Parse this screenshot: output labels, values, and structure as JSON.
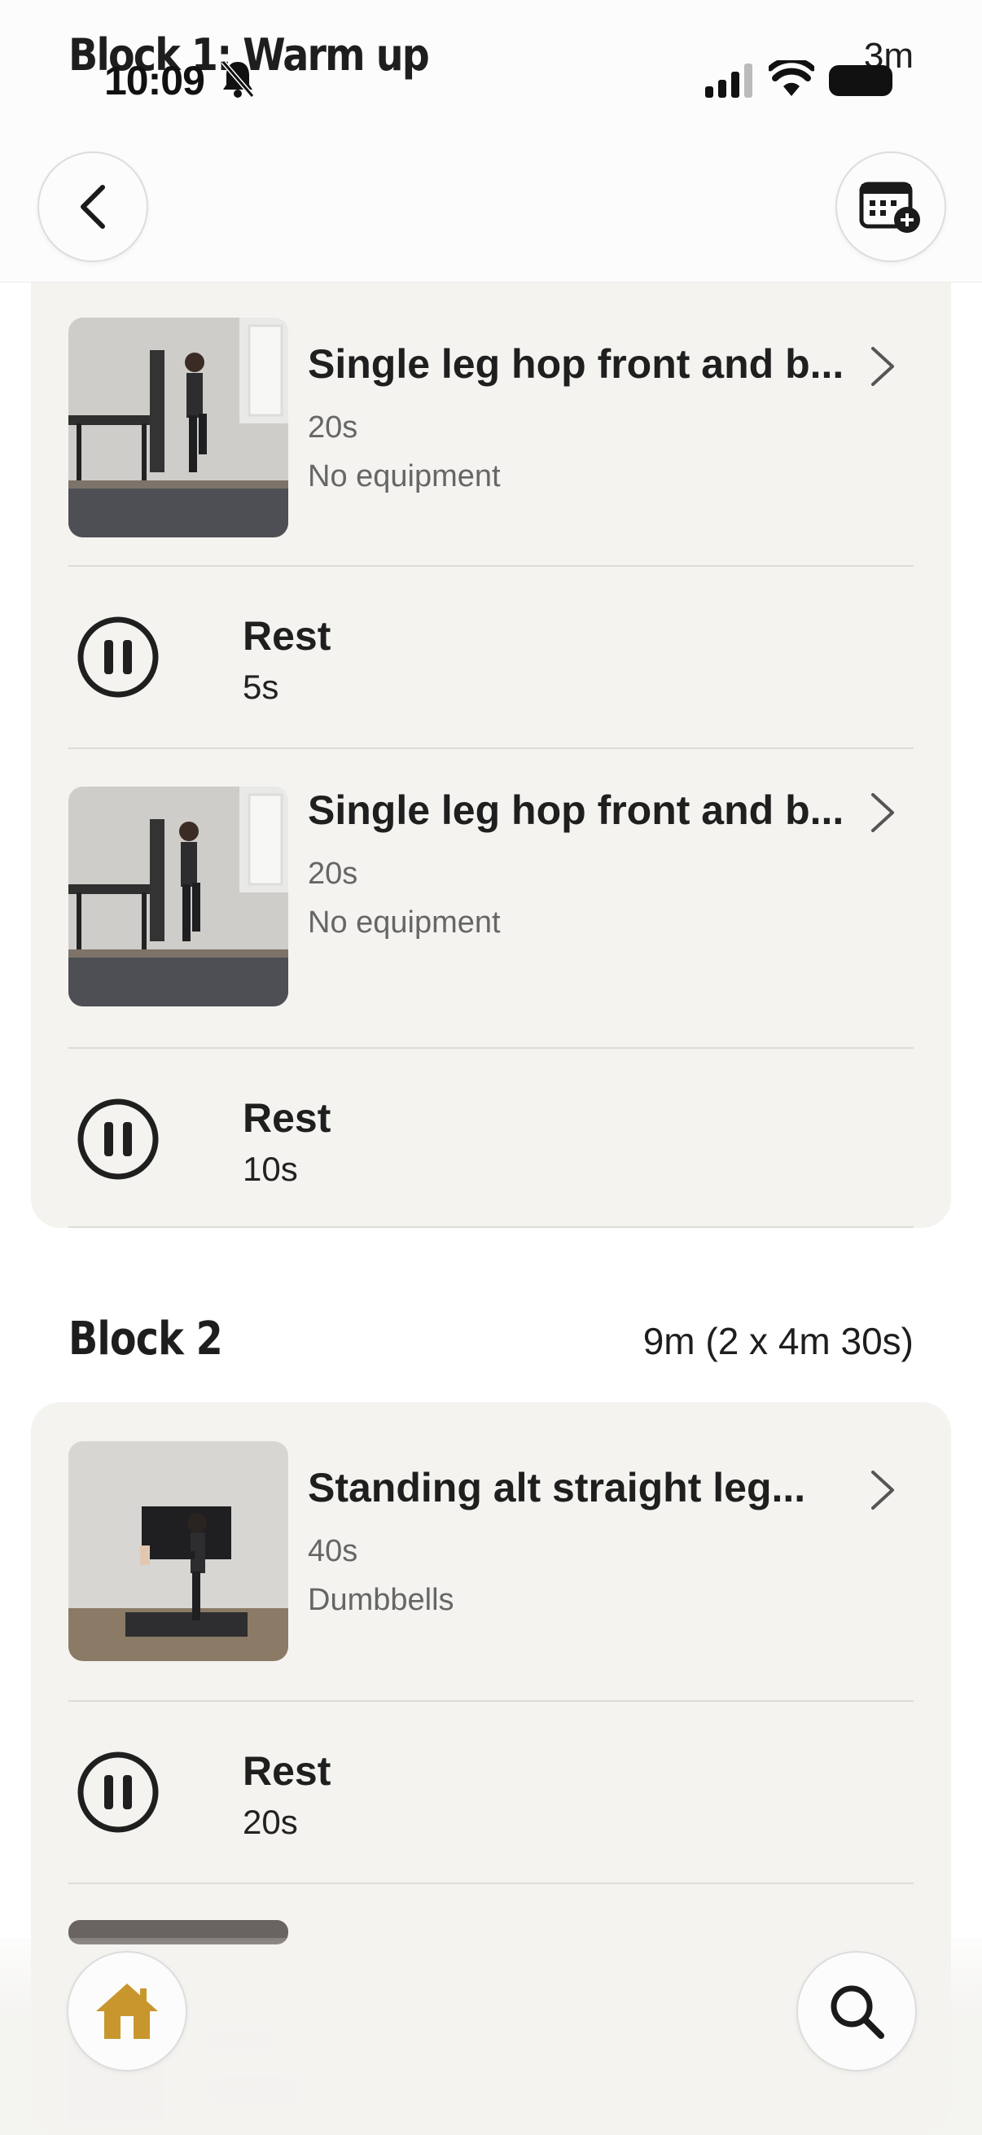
{
  "status_bar": {
    "time": "10:09"
  },
  "header": {
    "block_title": "Block 1: Warm up",
    "block_duration": "3m"
  },
  "block1": {
    "items": [
      {
        "type": "exercise",
        "name": "Single leg hop front and b...",
        "duration": "20s",
        "equipment": "No equipment"
      },
      {
        "type": "rest",
        "label": "Rest",
        "duration": "5s"
      },
      {
        "type": "exercise",
        "name": "Single leg hop front and b...",
        "duration": "20s",
        "equipment": "No equipment"
      },
      {
        "type": "rest",
        "label": "Rest",
        "duration": "10s"
      }
    ]
  },
  "block2": {
    "title": "Block 2",
    "duration": "9m (2 x 4m 30s)",
    "items": [
      {
        "type": "exercise",
        "name": "Standing alt straight leg...",
        "duration": "40s",
        "equipment": "Dumbbells"
      },
      {
        "type": "rest",
        "label": "Rest",
        "duration": "20s"
      }
    ]
  },
  "icons": {
    "back": "chevron-left-icon",
    "calendar": "calendar-add-icon",
    "home": "home-icon",
    "search": "search-icon",
    "pause": "pause-circle-icon",
    "chevron": "chevron-right-icon"
  },
  "colors": {
    "card_bg": "#f4f3f0",
    "home_accent": "#c9962e",
    "text_primary": "#1f1f1f",
    "text_secondary": "#666666"
  }
}
